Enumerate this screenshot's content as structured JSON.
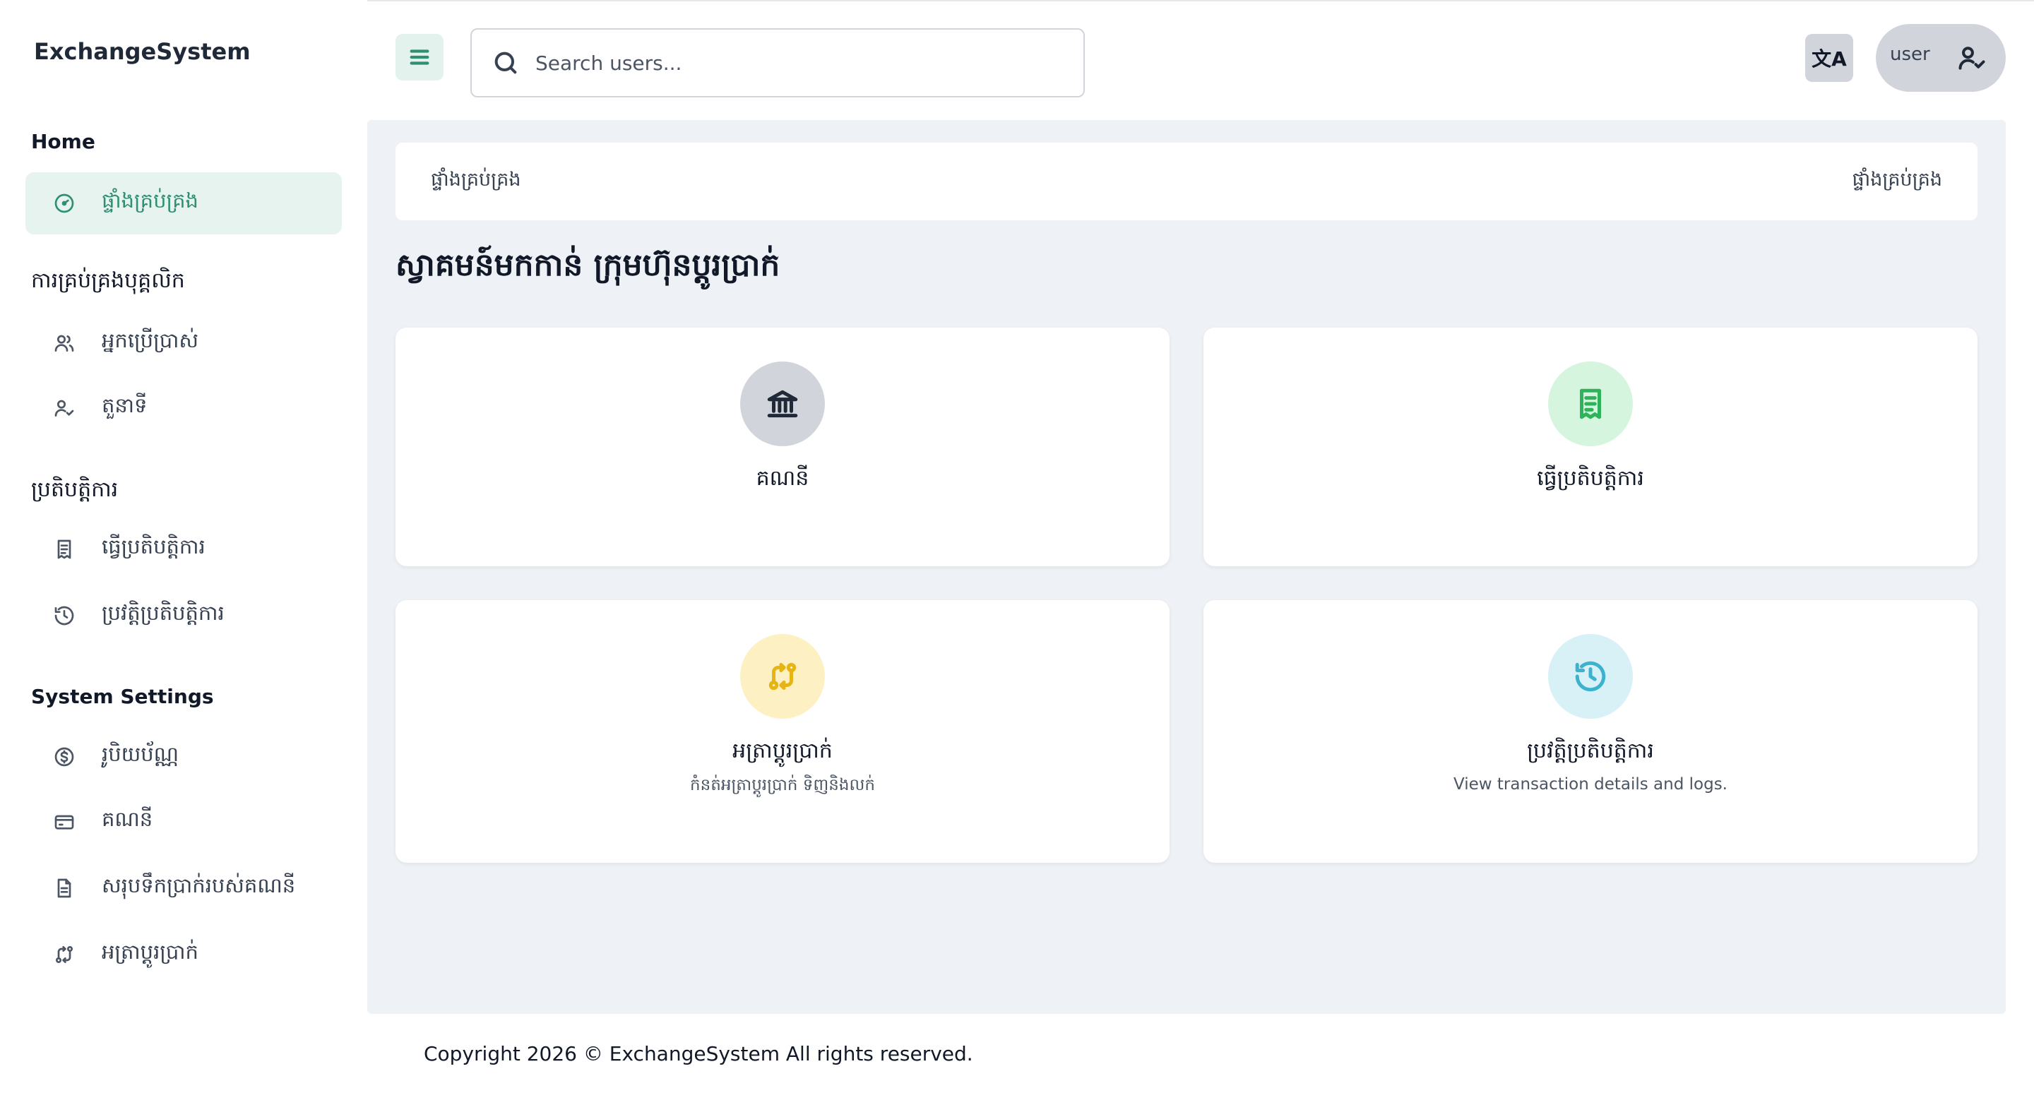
{
  "app": {
    "brand": "ExchangeSystem"
  },
  "sidebar": {
    "sections": [
      {
        "title": "Home"
      },
      {
        "title": "ការគ្រប់គ្រងបុគ្គលិក"
      },
      {
        "title": "ប្រតិបត្តិការ"
      },
      {
        "title": "System Settings"
      }
    ],
    "items": [
      {
        "label": "ផ្ទាំងគ្រប់គ្រង",
        "icon": "gauge-icon"
      },
      {
        "label": "អ្នកប្រើប្រាស់",
        "icon": "users-icon"
      },
      {
        "label": "តួនាទី",
        "icon": "user-check-icon"
      },
      {
        "label": "ធ្វើប្រតិបត្តិការ",
        "icon": "receipt-icon"
      },
      {
        "label": "ប្រវត្តិប្រតិបត្តិការ",
        "icon": "history-icon"
      },
      {
        "label": "រូបិយប័ណ្ណ",
        "icon": "dollar-circle-icon"
      },
      {
        "label": "គណនី",
        "icon": "credit-card-icon"
      },
      {
        "label": "សរុបទឹកប្រាក់របស់គណនី",
        "icon": "document-icon"
      },
      {
        "label": "អត្រាប្តូរប្រាក់",
        "icon": "exchange-icon"
      }
    ]
  },
  "header": {
    "search_placeholder": "Search users...",
    "lang_icon": "translate-icon",
    "avatar_alt": "user"
  },
  "breadcrumb": {
    "left": "ផ្ទាំងគ្រប់គ្រង",
    "right": "ផ្ទាំងគ្រប់គ្រង"
  },
  "page_title": "ស្វាគមន៍មកកាន់ ក្រុមហ៊ុនប្តូរប្រាក់",
  "cards": [
    {
      "title": "គណនី",
      "desc": "",
      "icon": "bank-icon",
      "bg": "#d1d5db",
      "fg": "#1f2937"
    },
    {
      "title": "ធ្វើប្រតិបត្តិការ",
      "desc": "",
      "icon": "receipt-icon",
      "bg": "#d6f5de",
      "fg": "#2fb35a"
    },
    {
      "title": "អត្រាប្តូរប្រាក់",
      "desc": "កំនត់អត្រាប្តូរប្រាក់ ទិញនិងលក់",
      "icon": "exchange-icon",
      "bg": "#fdf1c4",
      "fg": "#e7b416"
    },
    {
      "title": "ប្រវត្តិប្រតិបត្តិការ",
      "desc": "View transaction details and logs.",
      "icon": "history-icon",
      "bg": "#d7f1f7",
      "fg": "#3bb3cf"
    }
  ],
  "footer": {
    "text": "Copyright 2026 © ExchangeSystem All rights reserved."
  }
}
